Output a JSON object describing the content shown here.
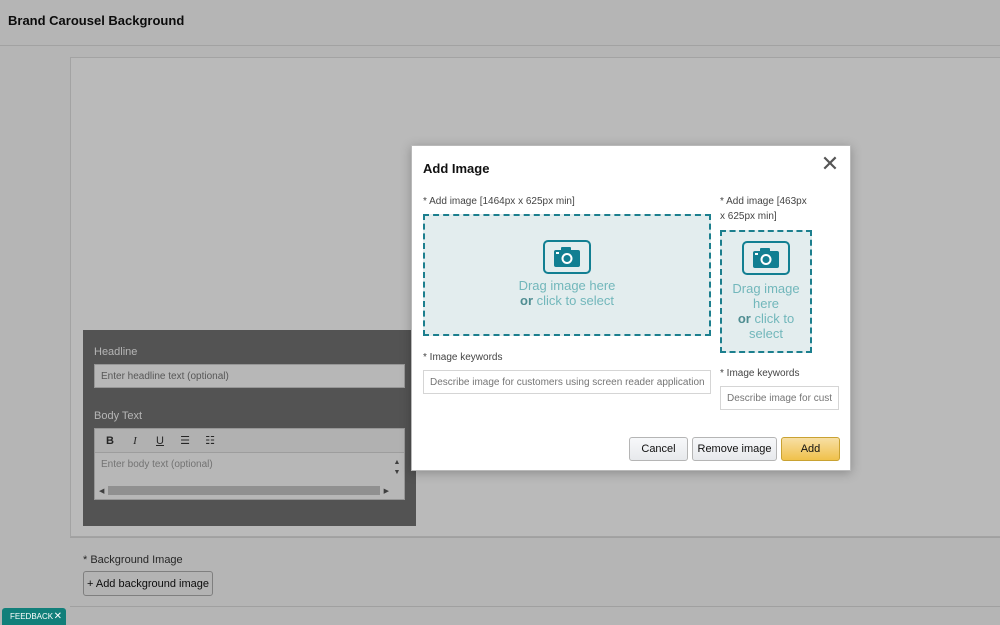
{
  "page": {
    "title": "Brand Carousel Background"
  },
  "editor": {
    "headline_label": "Headline",
    "headline_placeholder": "Enter headline text (optional)",
    "body_label": "Body Text",
    "toolbar": {
      "bold": "B",
      "italic": "I",
      "underline": "U",
      "bullets": "☰",
      "numbered": "☷"
    },
    "body_placeholder": "Enter body text (optional)"
  },
  "background": {
    "label": "* Background Image",
    "add_button": "+ Add background image"
  },
  "modal": {
    "title": "Add Image",
    "close": "✕",
    "large": {
      "label": "* Add image [1464px x 625px min]",
      "drop_line1": "Drag image here",
      "drop_or": "or",
      "drop_line2": " click to select",
      "keywords_label": "* Image keywords",
      "keywords_placeholder": "Describe image for customers using screen reader applications"
    },
    "small": {
      "label_line1": "* Add image [463px",
      "label_line2": "x 625px min]",
      "drop_line1": "Drag image",
      "drop_line2": "here",
      "drop_or": "or",
      "drop_line3": " click to",
      "drop_line4": "select",
      "keywords_label": "* Image keywords",
      "keywords_placeholder": "Describe image for customers"
    },
    "buttons": {
      "cancel": "Cancel",
      "remove": "Remove image",
      "add": "Add"
    }
  },
  "feedback": {
    "label": "FEEDBACK",
    "close": "✕"
  },
  "colors": {
    "accent_teal": "#127f92",
    "primary_button": "#f0c14b",
    "drop_background": "#e3edee"
  }
}
